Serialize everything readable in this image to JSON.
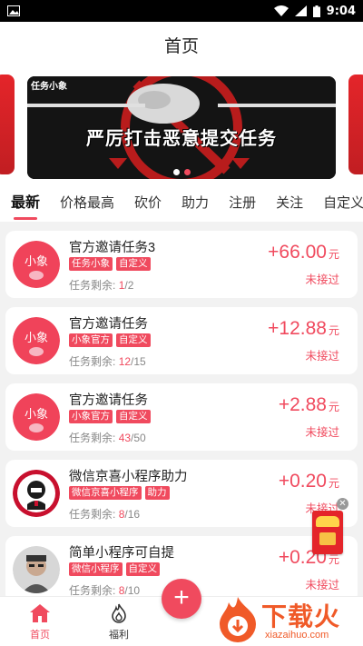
{
  "status_bar": {
    "time": "9:04"
  },
  "header": {
    "title": "首页"
  },
  "banner": {
    "label": "任务小象",
    "headline": "严厉打击恶意提交任务",
    "active_slide": 2,
    "slide_count": 2
  },
  "tabs": [
    "最新",
    "价格最高",
    "砍价",
    "助力",
    "注册",
    "关注",
    "自定义"
  ],
  "active_tab": "最新",
  "tasks": [
    {
      "title": "官方邀请任务3",
      "tags": [
        "任务小象",
        "自定义"
      ],
      "remain_label": "任务剩余:",
      "used": "1",
      "total": "/2",
      "price": "+66.00",
      "unit": "元",
      "status": "未接过",
      "avatar": "xiaoxiang-logo"
    },
    {
      "title": "官方邀请任务",
      "tags": [
        "小象官方",
        "自定义"
      ],
      "remain_label": "任务剩余:",
      "used": "12",
      "total": "/15",
      "price": "+12.88",
      "unit": "元",
      "status": "未接过",
      "avatar": "xiaoxiang-logo"
    },
    {
      "title": "官方邀请任务",
      "tags": [
        "小象官方",
        "自定义"
      ],
      "remain_label": "任务剩余:",
      "used": "43",
      "total": "/50",
      "price": "+2.88",
      "unit": "元",
      "status": "未接过",
      "avatar": "xiaoxiang-logo"
    },
    {
      "title": "微信京喜小程序助力",
      "tags": [
        "微信京喜小程序",
        "助力"
      ],
      "remain_label": "任务剩余:",
      "used": "8",
      "total": "/16",
      "price": "+0.20",
      "unit": "元",
      "status": "未接过",
      "avatar": "kfc-logo"
    },
    {
      "title": "简单小程序可自提",
      "tags": [
        "微信小程序",
        "自定义"
      ],
      "remain_label": "任务剩余:",
      "used": "8",
      "total": "/10",
      "price": "+0.20",
      "unit": "元",
      "status": "未接过",
      "avatar": "person-photo"
    }
  ],
  "avatar_text": "小象",
  "bottom_nav": {
    "home": "首页",
    "welfare": "福利"
  },
  "watermark": {
    "cn": "下载火",
    "en": "xiazaihuo.com"
  },
  "colors": {
    "accent": "#f04a5e",
    "status_bar": "#000000"
  }
}
